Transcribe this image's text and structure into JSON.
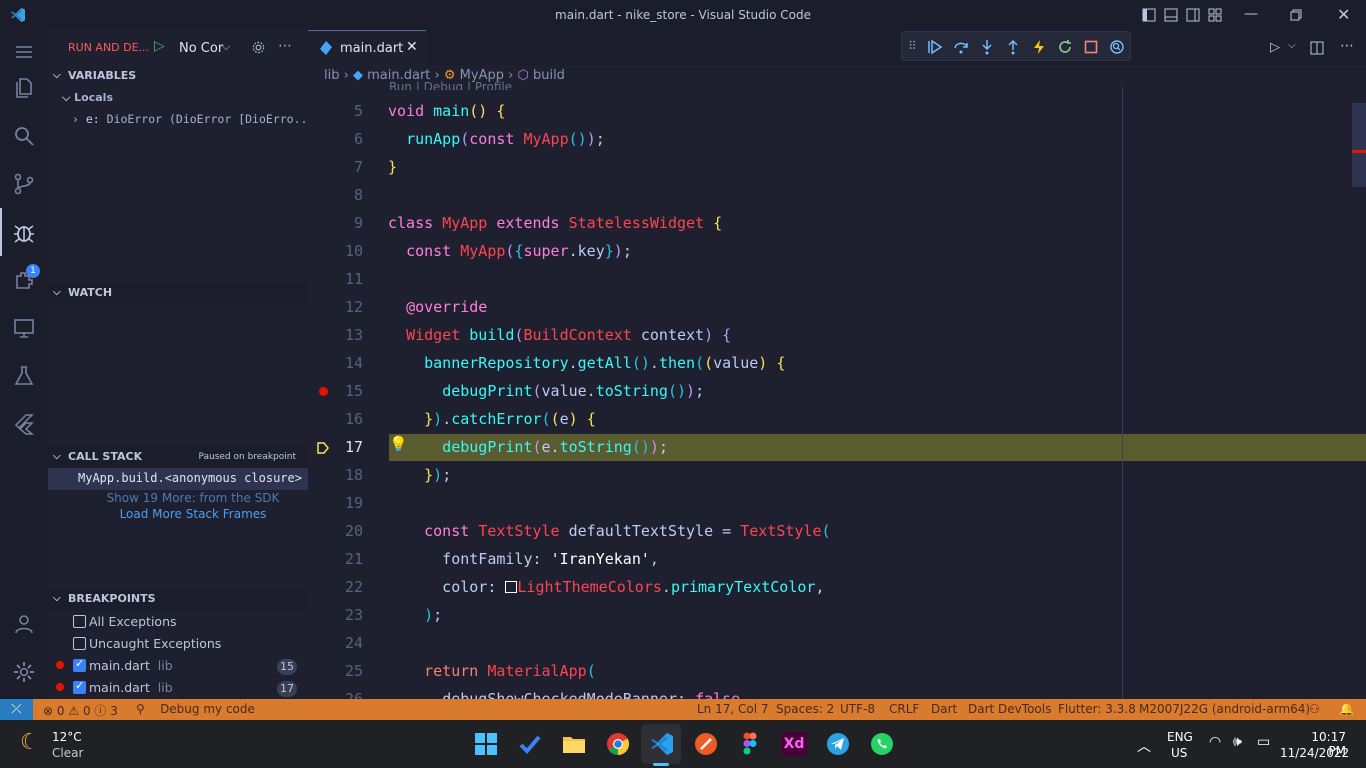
{
  "window": {
    "title": "main.dart - nike_store - Visual Studio Code"
  },
  "sidebar": {
    "title": "RUN AND DE...",
    "config": "No Cor",
    "variables": {
      "header": "VARIABLES",
      "locals": "Locals",
      "item_name": "e:",
      "item_value": "DioError (DioError [DioErro..."
    },
    "watch": {
      "header": "WATCH"
    },
    "callstack": {
      "header": "CALL STACK",
      "status": "Paused on breakpoint",
      "frame": "MyApp.build.<anonymous closure>",
      "more": "Show 19 More: from the SDK",
      "load": "Load More Stack Frames"
    },
    "breakpoints": {
      "header": "BREAKPOINTS",
      "items": [
        {
          "label": "All Exceptions",
          "checked": false
        },
        {
          "label": "Uncaught Exceptions",
          "checked": false
        },
        {
          "label": "main.dart",
          "sub": "lib",
          "line": "15",
          "checked": true
        },
        {
          "label": "main.dart",
          "sub": "lib",
          "line": "17",
          "checked": true
        }
      ]
    }
  },
  "activity_badge": "1",
  "editor": {
    "tab": "main.dart",
    "breadcrumbs": {
      "b1": "lib",
      "b2": "main.dart",
      "b3": "MyApp",
      "b4": "build"
    },
    "codelens": "Run | Debug | Profile",
    "lines": [
      "5",
      "6",
      "7",
      "8",
      "9",
      "10",
      "11",
      "12",
      "13",
      "14",
      "15",
      "16",
      "17",
      "18",
      "19",
      "20",
      "21",
      "22",
      "23",
      "24",
      "25",
      "26"
    ]
  },
  "statusbar": {
    "errors": "0",
    "warnings": "0",
    "info": "3",
    "debug": "Debug my code",
    "position": "Ln 17, Col 7",
    "spaces": "Spaces: 2",
    "encoding": "UTF-8",
    "eol": "CRLF",
    "lang": "Dart",
    "devtools": "Dart DevTools",
    "flutter": "Flutter: 3.3.8",
    "device": "M2007J22G (android-arm64)"
  },
  "taskbar": {
    "temp": "12°C",
    "weather": "Clear",
    "lang1": "ENG",
    "lang2": "US",
    "time": "10:17 PM",
    "date": "11/24/2022"
  }
}
